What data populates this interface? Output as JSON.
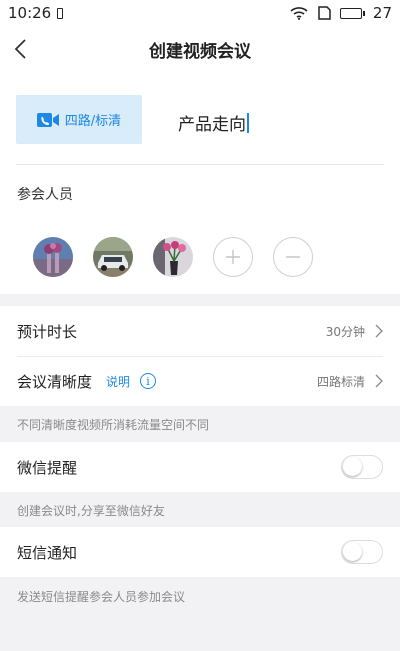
{
  "status_bar": {
    "time": "10:26",
    "battery_level": "27"
  },
  "nav": {
    "title": "创建视频会议"
  },
  "meeting": {
    "quality_button": "四路/标清",
    "topic": "产品走向",
    "participants_label": "参会人员",
    "participants": [
      {
        "icon": "avatar-purple-flowers"
      },
      {
        "icon": "avatar-car"
      },
      {
        "icon": "avatar-flowers-vase"
      }
    ]
  },
  "settings": {
    "duration": {
      "label": "预计时长",
      "value": "30分钟"
    },
    "clarity": {
      "label": "会议清晰度",
      "explain": "说明",
      "value": "四路标清"
    },
    "clarity_hint": "不同清晰度视频所消耗流量空间不同",
    "wechat": {
      "label": "微信提醒",
      "enabled": false
    },
    "wechat_hint": "创建会议时,分享至微信好友",
    "sms": {
      "label": "短信通知",
      "enabled": false
    },
    "sms_hint": "发送短信提醒参会人员参加会议"
  },
  "colors": {
    "accent": "#1e88e5",
    "quality_bg": "#d8ecfa",
    "page_bg": "#f2f2f4"
  }
}
